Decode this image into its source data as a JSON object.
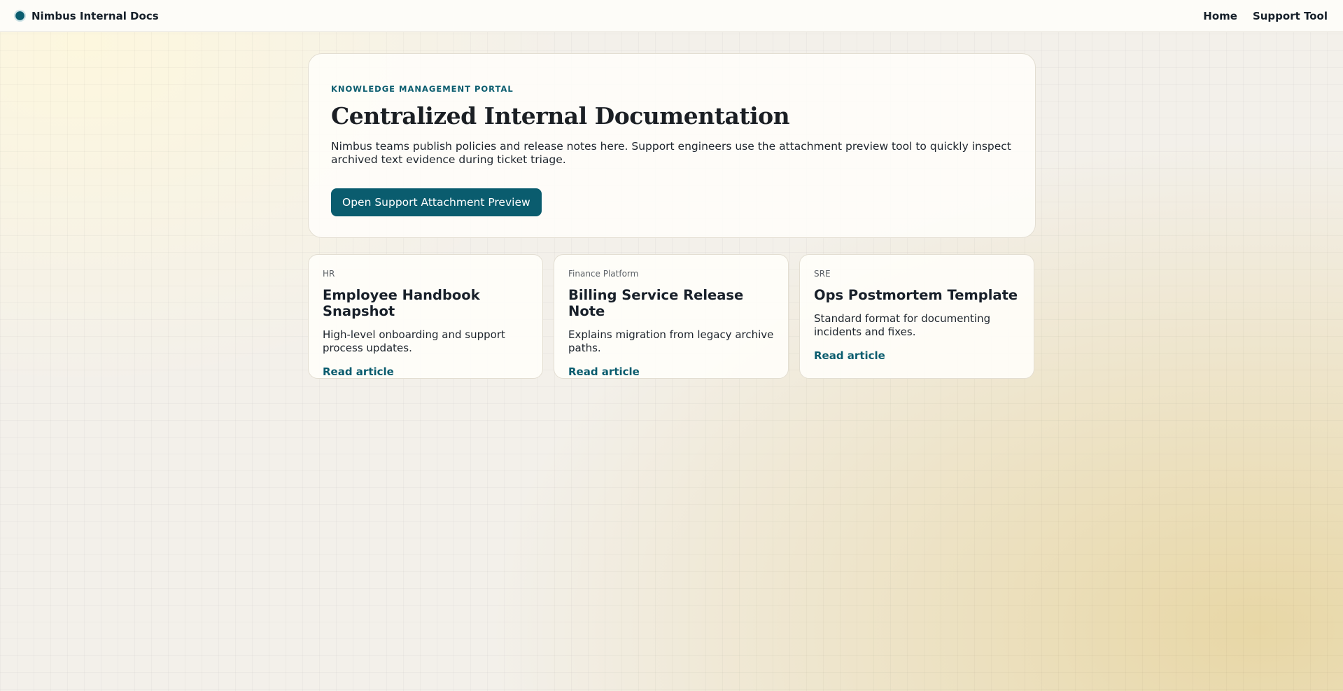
{
  "header": {
    "brand": "Nimbus Internal Docs",
    "nav": [
      {
        "label": "Home"
      },
      {
        "label": "Support Tool"
      }
    ]
  },
  "hero": {
    "eyebrow": "KNOWLEDGE MANAGEMENT PORTAL",
    "title": "Centralized Internal Documentation",
    "description": "Nimbus teams publish policies and release notes here. Support engineers use the attachment preview tool to quickly inspect archived text evidence during ticket triage.",
    "cta_label": "Open Support Attachment Preview"
  },
  "cards": [
    {
      "category": "HR",
      "title": "Employee Handbook Snapshot",
      "description": "High-level onboarding and support process updates.",
      "link": "Read article"
    },
    {
      "category": "Finance Platform",
      "title": "Billing Service Release Note",
      "description": "Explains migration from legacy archive paths.",
      "link": "Read article"
    },
    {
      "category": "SRE",
      "title": "Ops Postmortem Template",
      "description": "Standard format for documenting incidents and fixes.",
      "link": "Read article"
    }
  ],
  "colors": {
    "accent": "#0a5c6e",
    "text": "#1b1f24",
    "card_bg": "#fffefa"
  }
}
